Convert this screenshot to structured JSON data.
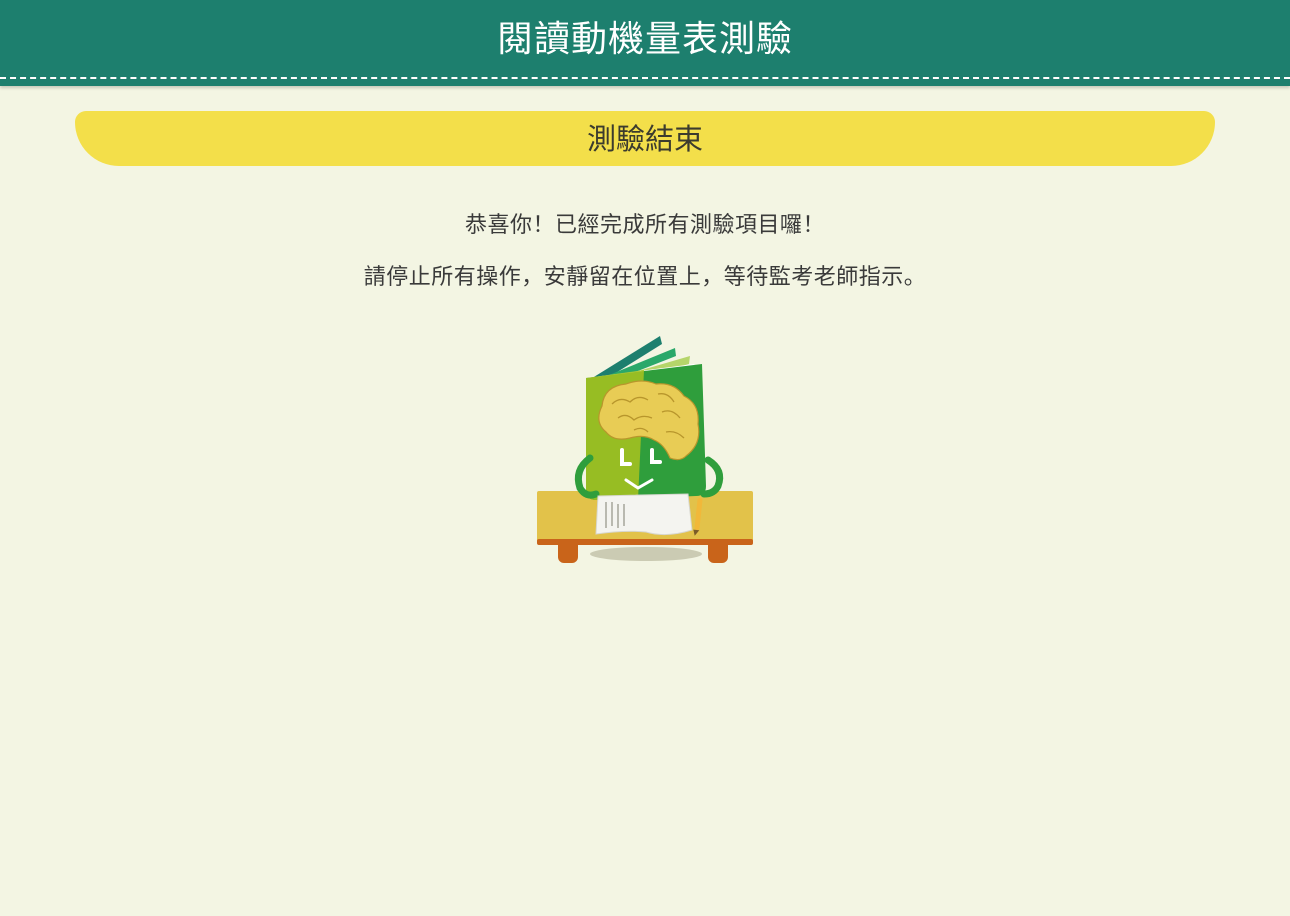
{
  "header": {
    "title": "閱讀動機量表測驗"
  },
  "section": {
    "title": "測驗結束"
  },
  "messages": {
    "congrats": "恭喜你！已經完成所有測驗項目囉！",
    "instruction": "請停止所有操作，安靜留在位置上，等待監考老師指示。"
  },
  "colors": {
    "header_bg": "#1d7f6e",
    "banner_bg": "#f3df4a",
    "page_bg": "#f3f5e3",
    "text": "#3a3a3a"
  },
  "illustration": {
    "icon": "book-mascot-at-desk-icon"
  }
}
